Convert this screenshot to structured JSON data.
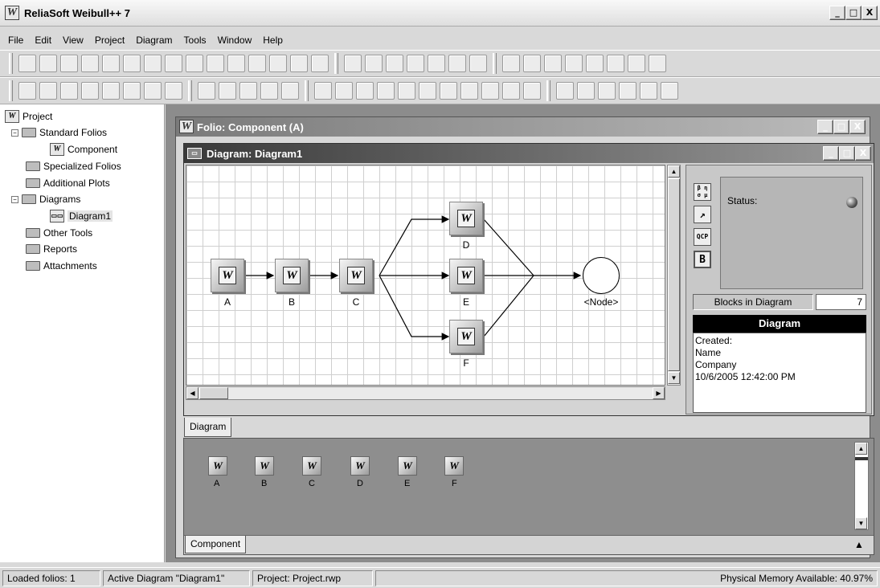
{
  "app": {
    "title": "ReliaSoft Weibull++ 7",
    "logo_letter": "W"
  },
  "menu": [
    "File",
    "Edit",
    "View",
    "Project",
    "Diagram",
    "Tools",
    "Window",
    "Help"
  ],
  "tree": {
    "root": "Project",
    "standard_folios": "Standard Folios",
    "component": "Component",
    "specialized_folios": "Specialized Folios",
    "additional_plots": "Additional Plots",
    "diagrams": "Diagrams",
    "diagram1": "Diagram1",
    "other_tools": "Other Tools",
    "reports": "Reports",
    "attachments": "Attachments"
  },
  "folio_window": {
    "title": "Folio: Component (A)"
  },
  "diagram_window": {
    "title": "Diagram: Diagram1",
    "blocks": [
      "A",
      "B",
      "C",
      "D",
      "E",
      "F"
    ],
    "node_label": "<Node>",
    "tab": "Diagram"
  },
  "panel": {
    "tools": [
      "β η\nσ μ",
      "↗",
      "QCP",
      "B"
    ],
    "status_label": "Status:",
    "blocks_label": "Blocks in Diagram",
    "blocks_value": "7",
    "info_header": "Diagram",
    "info_lines": [
      "Created:",
      "Name",
      "Company",
      "10/6/2005 12:42:00 PM"
    ]
  },
  "bottom": {
    "items": [
      "A",
      "B",
      "C",
      "D",
      "E",
      "F"
    ],
    "tab": "Component"
  },
  "statusbar": {
    "loaded": "Loaded folios: 1",
    "active": "Active Diagram \"Diagram1\"",
    "project": "Project: Project.rwp",
    "memory": "Physical Memory Available: 40.97%"
  },
  "window_buttons": {
    "minimize": "_",
    "maximize": "□",
    "close": "X"
  },
  "colors": {
    "titlebar_active": "#3a3a3a",
    "folio_title": "#7a7a7a",
    "mdi_bg": "#8c8c8c"
  }
}
